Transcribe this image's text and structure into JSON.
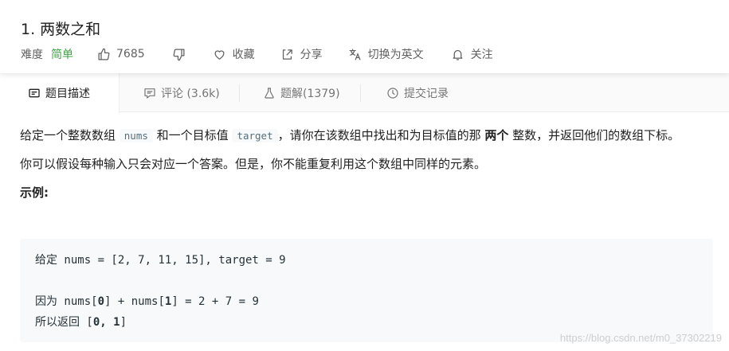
{
  "problem": {
    "title": "1. 两数之和",
    "difficulty_label": "难度",
    "difficulty_value": "简单",
    "likes": "7685",
    "collect_label": "收藏",
    "share_label": "分享",
    "lang_label": "切换为英文",
    "follow_label": "关注"
  },
  "tabs": [
    {
      "label": "题目描述"
    },
    {
      "label": "评论 (3.6k)"
    },
    {
      "label": "题解(1379)"
    },
    {
      "label": "提交记录"
    }
  ],
  "description": {
    "p1_a": "给定一个整数数组 ",
    "p1_code1": "nums",
    "p1_b": " 和一个目标值 ",
    "p1_code2": "target",
    "p1_c": "，请你在该数组中找出和为目标值的那 ",
    "p1_bold": "两个",
    "p1_d": " 整数，并返回他们的数组下标。",
    "p2": "你可以假设每种输入只会对应一个答案。但是，你不能重复利用这个数组中同样的元素。",
    "example_title": "示例:"
  },
  "example": {
    "line1_cn": "给定",
    "line1_code": " nums = [2, 7, 11, 15], target = 9",
    "line2_cn": "因为",
    "line2_a": " nums[",
    "line2_b1": "0",
    "line2_c": "] + nums[",
    "line2_b2": "1",
    "line2_d": "] = 2 + 7 = 9",
    "line3_cn": "所以返回",
    "line3_a": " [",
    "line3_b": "0, 1",
    "line3_c": "]"
  },
  "watermark": "https://blog.csdn.net/m0_37302219"
}
